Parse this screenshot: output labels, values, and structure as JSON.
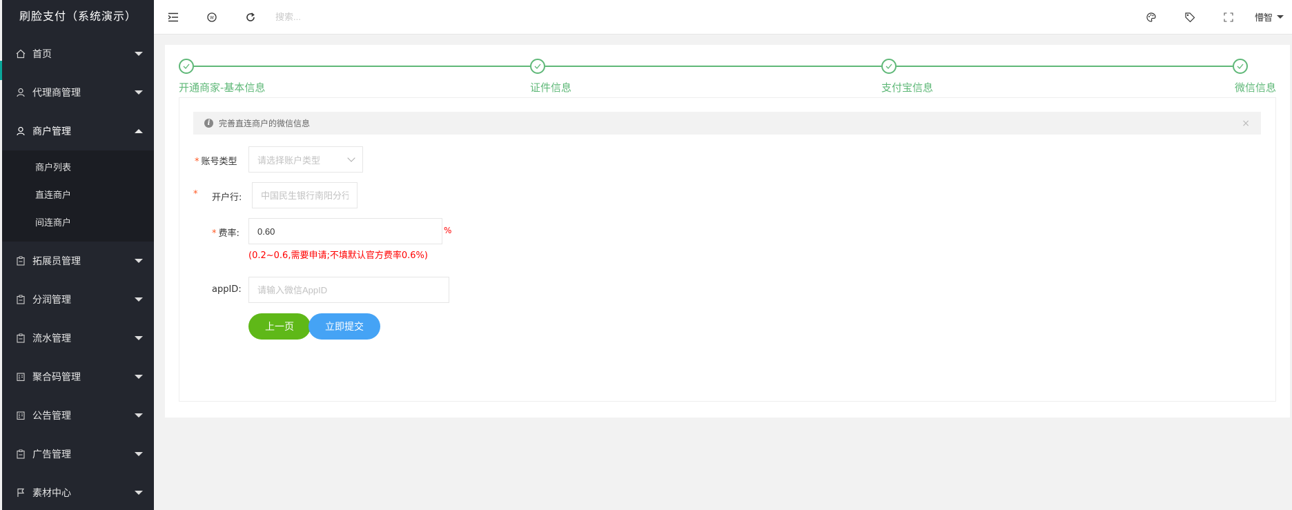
{
  "app_title": "刷脸支付（系统演示）",
  "sidebar": {
    "items": [
      {
        "label": "首页",
        "icon": "home-icon",
        "expanded": false
      },
      {
        "label": "代理商管理",
        "icon": "user-icon",
        "expanded": false
      },
      {
        "label": "商户管理",
        "icon": "user-icon",
        "expanded": true,
        "children": [
          "商户列表",
          "直连商户",
          "间连商户"
        ]
      },
      {
        "label": "拓展员管理",
        "icon": "clipboard-icon",
        "expanded": false
      },
      {
        "label": "分润管理",
        "icon": "clipboard-icon",
        "expanded": false
      },
      {
        "label": "流水管理",
        "icon": "clipboard-icon",
        "expanded": false
      },
      {
        "label": "聚合码管理",
        "icon": "book-icon",
        "expanded": false
      },
      {
        "label": "公告管理",
        "icon": "book-icon",
        "expanded": false
      },
      {
        "label": "广告管理",
        "icon": "clipboard-icon",
        "expanded": false
      },
      {
        "label": "素材中心",
        "icon": "flag-icon",
        "expanded": false
      }
    ]
  },
  "topbar": {
    "search_placeholder": "搜索...",
    "username": "懵智"
  },
  "steps": [
    "开通商家-基本信息",
    "证件信息",
    "支付宝信息",
    "微信信息"
  ],
  "alert": {
    "text": "完善直连商户的微信信息",
    "close": "×"
  },
  "form": {
    "account_type": {
      "label": "账号类型",
      "placeholder": "请选择账户类型"
    },
    "bank": {
      "label": "开户行:",
      "placeholder": "中国民生银行南阳分行营业部"
    },
    "rate": {
      "label": "费率:",
      "value": "0.60",
      "unit": "%",
      "hint": "(0.2~0.6,需要申请;不填默认官方费率0.6%)"
    },
    "appid": {
      "label": "appID:",
      "placeholder": "请输入微信AppID"
    },
    "prev_button": "上一页",
    "submit_button": "立即提交"
  },
  "colors": {
    "sidebar_bg": "#23262e",
    "step_green": "#5fb878",
    "prev_btn": "#5fb818",
    "submit_btn": "#45a3f5",
    "required": "#ff5722",
    "hint_red": "#ff0000"
  }
}
